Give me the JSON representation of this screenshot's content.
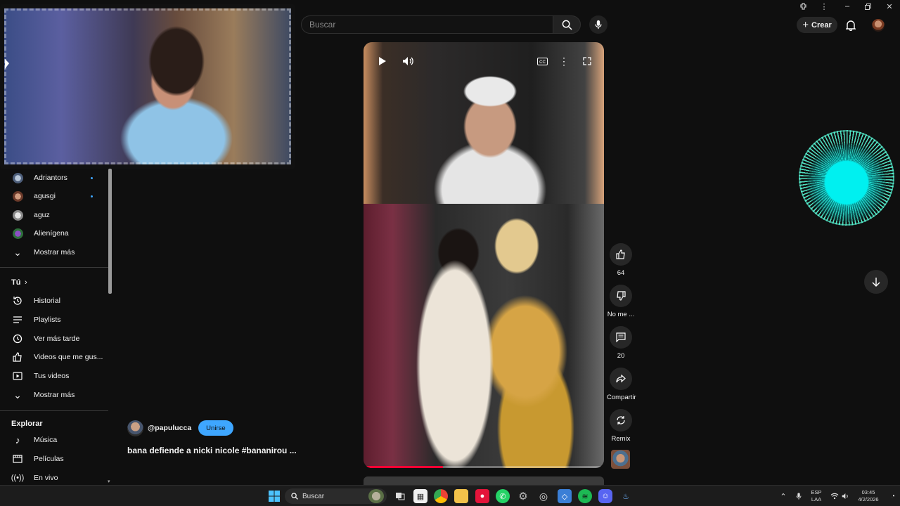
{
  "header": {
    "search_placeholder": "Buscar",
    "create_label": "Crear"
  },
  "sidebar": {
    "subscriptions": [
      {
        "label": "Adriantors",
        "has_new": true
      },
      {
        "label": "agusgi",
        "has_new": true
      },
      {
        "label": "aguz",
        "has_new": false
      },
      {
        "label": "Alienígena",
        "has_new": false
      }
    ],
    "show_more_1": "Mostrar más",
    "you_section": "Tú",
    "you_items": [
      {
        "label": "Historial",
        "icon": "history-icon"
      },
      {
        "label": "Playlists",
        "icon": "playlists-icon"
      },
      {
        "label": "Ver más tarde",
        "icon": "watch-later-icon"
      },
      {
        "label": "Videos que me gus...",
        "icon": "liked-videos-icon"
      },
      {
        "label": "Tus videos",
        "icon": "your-videos-icon"
      }
    ],
    "show_more_2": "Mostrar más",
    "explore_section": "Explorar",
    "explore_items": [
      {
        "label": "Música",
        "icon": "music-icon"
      },
      {
        "label": "Películas",
        "icon": "movies-icon"
      },
      {
        "label": "En vivo",
        "icon": "live-icon"
      }
    ]
  },
  "short": {
    "channel": "@papulucca",
    "join_label": "Unirse",
    "title": "bana defiende a nicki nicole #bananirou ...",
    "progress": 0.33,
    "actions": {
      "like_count": "64",
      "dislike_label": "No me ...",
      "comments_count": "20",
      "share_label": "Compartir",
      "remix_label": "Remix"
    }
  },
  "taskbar": {
    "search_label": "Buscar",
    "lang_top": "ESP",
    "lang_bottom": "LAA",
    "time": "03:45",
    "date": "4/2/2026"
  },
  "colors": {
    "accent": "#3ea6ff",
    "progress": "#ff0033",
    "background": "#0f0f0f",
    "visualizer": "#00f0f0"
  }
}
